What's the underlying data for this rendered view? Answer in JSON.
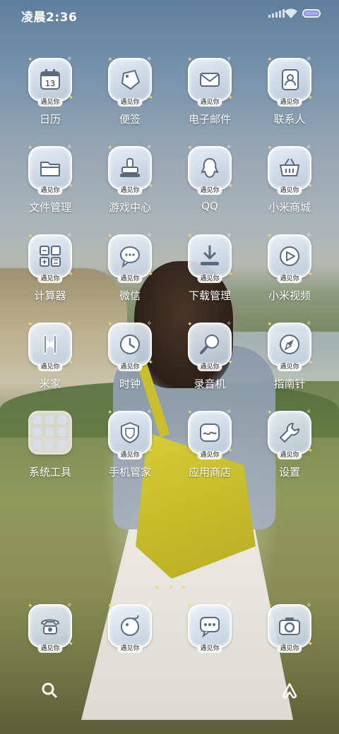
{
  "status": {
    "time": "凌晨2:36"
  },
  "badge": "遇见你",
  "apps": [
    {
      "label": "日历",
      "icon": "calendar-icon",
      "date": "13"
    },
    {
      "label": "便签",
      "icon": "notes-icon"
    },
    {
      "label": "电子邮件",
      "icon": "mail-icon"
    },
    {
      "label": "联系人",
      "icon": "contacts-icon"
    },
    {
      "label": "文件管理",
      "icon": "folder-icon"
    },
    {
      "label": "游戏中心",
      "icon": "game-center-icon"
    },
    {
      "label": "QQ",
      "icon": "qq-icon"
    },
    {
      "label": "小米商城",
      "icon": "shop-basket-icon"
    },
    {
      "label": "计算器",
      "icon": "calculator-icon"
    },
    {
      "label": "微信",
      "icon": "wechat-icon"
    },
    {
      "label": "下载管理",
      "icon": "download-icon"
    },
    {
      "label": "小米视频",
      "icon": "video-play-icon"
    },
    {
      "label": "米家",
      "icon": "mijia-icon"
    },
    {
      "label": "时钟",
      "icon": "clock-icon"
    },
    {
      "label": "录音机",
      "icon": "microphone-icon"
    },
    {
      "label": "指南针",
      "icon": "compass-icon"
    },
    {
      "label": "系统工具",
      "icon": "folder-grid-icon"
    },
    {
      "label": "手机管家",
      "icon": "shield-icon"
    },
    {
      "label": "应用商店",
      "icon": "app-store-icon"
    },
    {
      "label": "设置",
      "icon": "wrench-icon"
    }
  ],
  "dock": [
    {
      "icon": "phone-icon"
    },
    {
      "icon": "browser-icon"
    },
    {
      "icon": "message-icon"
    },
    {
      "icon": "camera-icon"
    }
  ],
  "nav": {
    "left": "search-icon",
    "right": "assistant-icon"
  },
  "colors": {
    "badge_bg": "#ffffff",
    "battery": "#a8a7f5",
    "spark": "#f5d76e"
  }
}
